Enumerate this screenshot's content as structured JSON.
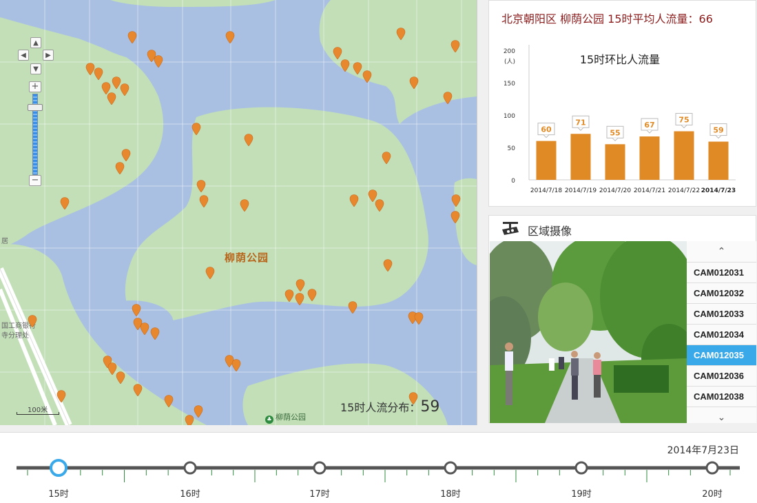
{
  "map": {
    "park_name": "柳荫公园",
    "labels": {
      "bank": "国工商银行",
      "office": "寺分理处",
      "ju": "居"
    },
    "pan_icons": [
      "arrow-up-icon",
      "arrow-left-icon",
      "arrow-right-icon",
      "arrow-down-icon"
    ],
    "zoom_in": "+",
    "zoom_out": "−",
    "scale_label": "100米",
    "flow_label": "15时人流分布：",
    "flow_value": "59",
    "logo_text": "柳荫公园",
    "colors": {
      "water": "#a9c0e2",
      "land": "#c2dfb8",
      "pin": "#e8882e"
    }
  },
  "chart_panel": {
    "header": "北京朝阳区 柳荫公园  15时平均人流量：66"
  },
  "chart_data": {
    "type": "bar",
    "title": "15时环比人流量",
    "ylabel": "(人)",
    "ylim": [
      0,
      200
    ],
    "yticks": [
      "0",
      "50",
      "100",
      "150",
      "200"
    ],
    "categories": [
      "2014/7/18",
      "2014/7/19",
      "2014/7/20",
      "2014/7/21",
      "2014/7/22",
      "2014/7/23"
    ],
    "values": [
      60,
      71,
      55,
      67,
      75,
      59
    ],
    "labels": [
      "60",
      "71",
      "55",
      "67",
      "75",
      "59"
    ],
    "bar_heights_reference": [
      66,
      71,
      58,
      69,
      81,
      64
    ],
    "highlight_category": "2014/7/23",
    "bar_color": "#e08a25"
  },
  "camera_panel": {
    "title": "区域摄像",
    "scroll_up": "⌃",
    "scroll_down": "⌄",
    "cameras": [
      "CAM012031",
      "CAM012032",
      "CAM012033",
      "CAM012034",
      "CAM012035",
      "CAM012036",
      "CAM012038"
    ],
    "active_camera": "CAM012035"
  },
  "timeline": {
    "date": "2014年7月23日",
    "hours": [
      "15时",
      "16时",
      "17时",
      "18时",
      "19时",
      "20时"
    ],
    "active_hour": "15时"
  }
}
